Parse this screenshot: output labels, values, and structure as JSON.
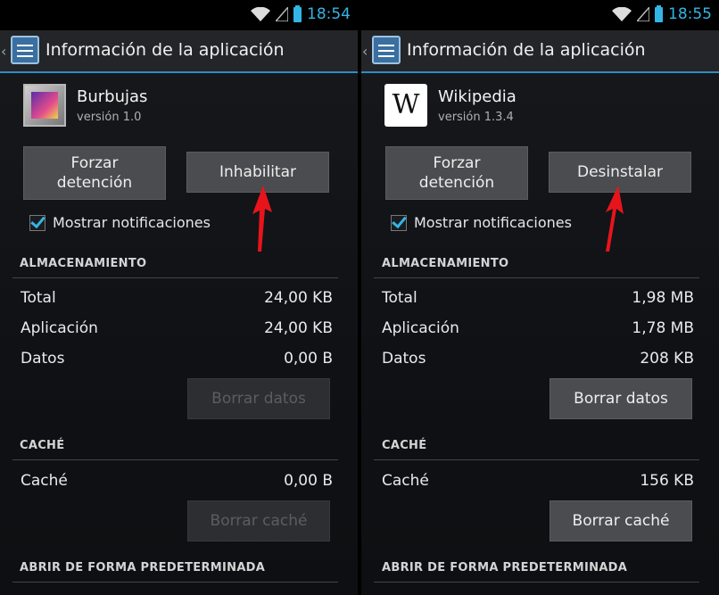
{
  "left": {
    "status_time": "18:54",
    "title": "Información de la aplicación",
    "app_name": "Burbujas",
    "app_version": "versión 1.0",
    "force_stop_label": "Forzar\ndetención",
    "action_button_label": "Inhabilitar",
    "notifications_label": "Mostrar notificaciones",
    "storage_header": "ALMACENAMIENTO",
    "rows": [
      {
        "label": "Total",
        "value": "24,00 KB"
      },
      {
        "label": "Aplicación",
        "value": "24,00 KB"
      },
      {
        "label": "Datos",
        "value": "0,00 B"
      }
    ],
    "clear_data_label": "Borrar datos",
    "cache_header": "CACHÉ",
    "cache_label": "Caché",
    "cache_value": "0,00 B",
    "clear_cache_label": "Borrar caché",
    "open_default_header": "ABRIR DE FORMA PREDETERMINADA"
  },
  "right": {
    "status_time": "18:55",
    "title": "Información de la aplicación",
    "app_name": "Wikipedia",
    "app_version": "versión 1.3.4",
    "force_stop_label": "Forzar\ndetención",
    "action_button_label": "Desinstalar",
    "notifications_label": "Mostrar notificaciones",
    "storage_header": "ALMACENAMIENTO",
    "rows": [
      {
        "label": "Total",
        "value": "1,98 MB"
      },
      {
        "label": "Aplicación",
        "value": "1,78 MB"
      },
      {
        "label": "Datos",
        "value": "208 KB"
      }
    ],
    "clear_data_label": "Borrar datos",
    "cache_header": "CACHÉ",
    "cache_label": "Caché",
    "cache_value": "156 KB",
    "clear_cache_label": "Borrar caché",
    "open_default_header": "ABRIR DE FORMA PREDETERMINADA"
  },
  "icons": {
    "wikipedia_glyph": "W"
  },
  "colors": {
    "accent": "#33b5e5",
    "arrow": "#e8141c",
    "button": "#4a4c4f",
    "button_disabled": "#2c2e31"
  }
}
